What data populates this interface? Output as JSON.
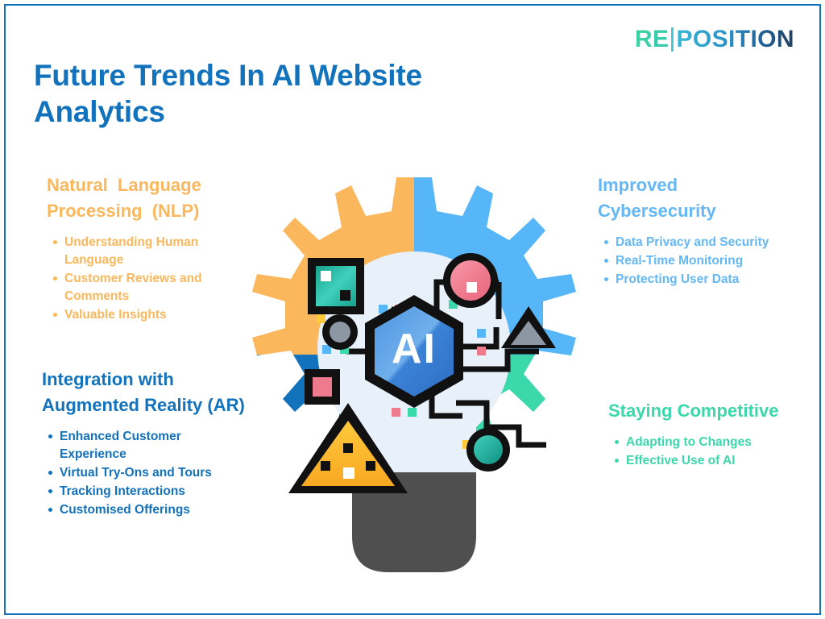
{
  "slide": {
    "title": "Future Trends In AI Website Analytics",
    "frame_color": "#1272BC",
    "background": "#ffffff"
  },
  "logo": {
    "part1": "RE",
    "part2": "POSITION",
    "divider": "|",
    "colors": {
      "start": "#3FD1A0",
      "mid": "#35B9D6",
      "end": "#25405C"
    }
  },
  "blocks": {
    "nlp": {
      "heading": "Natural  Language Processing (NLP)",
      "color": "#FBB75C",
      "bullets": [
        "Understanding Human Language",
        "Customer Reviews and Comments",
        "Valuable Insights"
      ]
    },
    "ar": {
      "heading": "Integration with Augmented Reality (AR)",
      "color": "#1272BC",
      "bullets": [
        "Enhanced Customer Experience",
        "Virtual Try-Ons and Tours",
        "Tracking Interactions",
        "Customised Offerings"
      ]
    },
    "cyber": {
      "heading": "Improved Cybersecurity",
      "color": "#63B8F5",
      "bullets": [
        "Data Privacy and Security",
        "Real-Time Monitoring",
        "Protecting User Data"
      ]
    },
    "competitive": {
      "heading": "Staying Competitive",
      "color": "#3BD8AB",
      "bullets": [
        "Adapting to Changes",
        "Effective Use of AI"
      ]
    }
  },
  "graphic": {
    "name": "ai-lightbulb-gear-illustration",
    "center_label": "AI",
    "gear_colors": {
      "top_left": "#FBB75C",
      "top_right": "#56B6F7",
      "bottom_left": "#1272BC",
      "bottom_right": "#3BD8AB"
    },
    "bulb_color": "#E8F1FA",
    "base_color": "#4F4F4F",
    "hexagon_color": "#3B82D6",
    "accent_shapes": [
      "teal-square",
      "pink-circle",
      "gray-circle",
      "gray-triangle",
      "pink-square",
      "amber-triangle",
      "teal-circle"
    ]
  }
}
